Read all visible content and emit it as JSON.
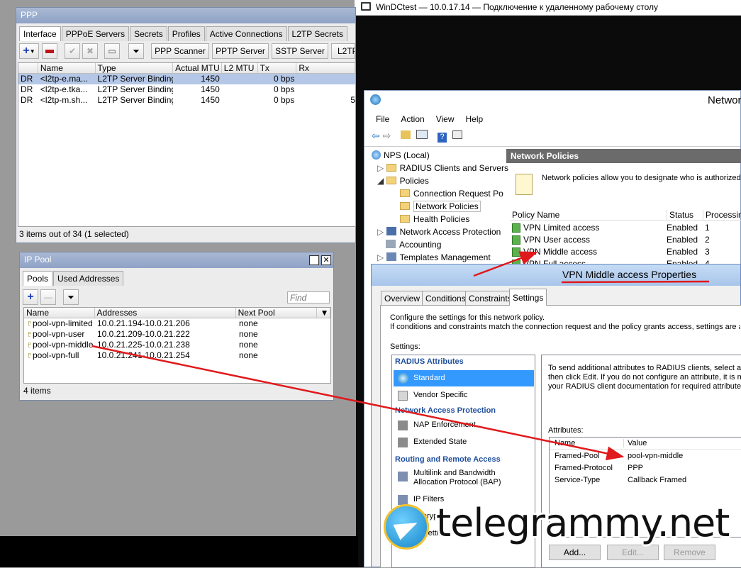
{
  "ppp": {
    "title": "PPP",
    "tabs": [
      "Interface",
      "PPPoE Servers",
      "Secrets",
      "Profiles",
      "Active Connections",
      "L2TP Secrets"
    ],
    "buttons": {
      "pppoe_scan": "PPP Scanner",
      "pptp": "PPTP Server",
      "sstp": "SSTP Server",
      "l2tp": "L2TP"
    },
    "columns": [
      "",
      "Name",
      "Type",
      "Actual MTU",
      "L2 MTU",
      "Tx",
      "Rx"
    ],
    "rows": [
      {
        "flag": "DR",
        "name": "<l2tp-e.ma...",
        "type": "L2TP Server Binding",
        "mtu": "1450",
        "l2mtu": "",
        "tx": "0 bps",
        "rx": ""
      },
      {
        "flag": "DR",
        "name": "<l2tp-e.tka...",
        "type": "L2TP Server Binding",
        "mtu": "1450",
        "l2mtu": "",
        "tx": "0 bps",
        "rx": ""
      },
      {
        "flag": "DR",
        "name": "<l2tp-m.sh...",
        "type": "L2TP Server Binding",
        "mtu": "1450",
        "l2mtu": "",
        "tx": "0 bps",
        "rx": "5"
      }
    ],
    "status": "3 items out of 34 (1 selected)"
  },
  "ippool": {
    "title": "IP Pool",
    "tabs": [
      "Pools",
      "Used Addresses"
    ],
    "find_placeholder": "Find",
    "columns": [
      "Name",
      "Addresses",
      "Next Pool"
    ],
    "rows": [
      {
        "name": "pool-vpn-limited",
        "addresses": "10.0.21.194-10.0.21.206",
        "next": "none"
      },
      {
        "name": "pool-vpn-user",
        "addresses": "10.0.21.209-10.0.21.222",
        "next": "none"
      },
      {
        "name": "pool-vpn-middle",
        "addresses": "10.0.21.225-10.0.21.238",
        "next": "none"
      },
      {
        "name": "pool-vpn-full",
        "addresses": "10.0.21.241-10.0.21.254",
        "next": "none"
      }
    ],
    "status": "4 items"
  },
  "rdp": {
    "title": "WinDCtest — 10.0.17.14 — Подключение к удаленному рабочему столу"
  },
  "nps": {
    "title": "Networ",
    "menu": [
      "File",
      "Action",
      "View",
      "Help"
    ],
    "tree": {
      "root": "NPS (Local)",
      "radius": "RADIUS Clients and Servers",
      "policies": "Policies",
      "crp": "Connection Request Po",
      "np": "Network Policies",
      "hp": "Health Policies",
      "nap": "Network Access Protection",
      "acct": "Accounting",
      "tmpl": "Templates Management"
    },
    "panel_header": "Network Policies",
    "panel_desc": "Network policies allow you to designate who is authorized to",
    "columns": [
      "Policy Name",
      "Status",
      "Processing"
    ],
    "policies": [
      {
        "name": "VPN Limited access",
        "status": "Enabled",
        "order": "1"
      },
      {
        "name": "VPN User access",
        "status": "Enabled",
        "order": "2"
      },
      {
        "name": "VPN Middle access",
        "status": "Enabled",
        "order": "3"
      },
      {
        "name": "VPN Full access",
        "status": "Enabled",
        "order": "4"
      }
    ]
  },
  "props": {
    "title": "VPN Middle access Properties",
    "tabs": [
      "Overview",
      "Conditions",
      "Constraints",
      "Settings"
    ],
    "desc1": "Configure the settings for this network policy.",
    "desc2": "If conditions and constraints match the connection request and the policy grants access, settings are appl",
    "settings_label": "Settings:",
    "sections": {
      "radius": "RADIUS Attributes",
      "standard": "Standard",
      "vendor": "Vendor Specific",
      "nap": "Network Access Protection",
      "nap_enf": "NAP Enforcement",
      "ext": "Extended State",
      "rra": "Routing and Remote Access",
      "bap1": "Multilink and Bandwidth",
      "bap2": "Allocation Protocol (BAP)",
      "ipf": "IP Filters",
      "enc": "Encryption",
      "ipset": "IP Settings"
    },
    "right_desc1": "To send additional attributes to RADIUS clients, select a R",
    "right_desc2": "then click Edit. If you do not configure an attribute, it is not",
    "right_desc3": "your RADIUS client documentation for required attributes.",
    "attributes_label": "Attributes:",
    "attr_columns": [
      "Name",
      "Value"
    ],
    "attributes": [
      {
        "name": "Framed-Pool",
        "value": "pool-vpn-middle"
      },
      {
        "name": "Framed-Protocol",
        "value": "PPP"
      },
      {
        "name": "Service-Type",
        "value": "Callback Framed"
      }
    ],
    "buttons": {
      "add": "Add...",
      "edit": "Edit...",
      "remove": "Remove"
    }
  },
  "watermark": "telegrammy.net",
  "colors": {
    "arrow": "#e0191c",
    "selection": "#b4c7e7",
    "nps_selection": "#3399ff"
  }
}
